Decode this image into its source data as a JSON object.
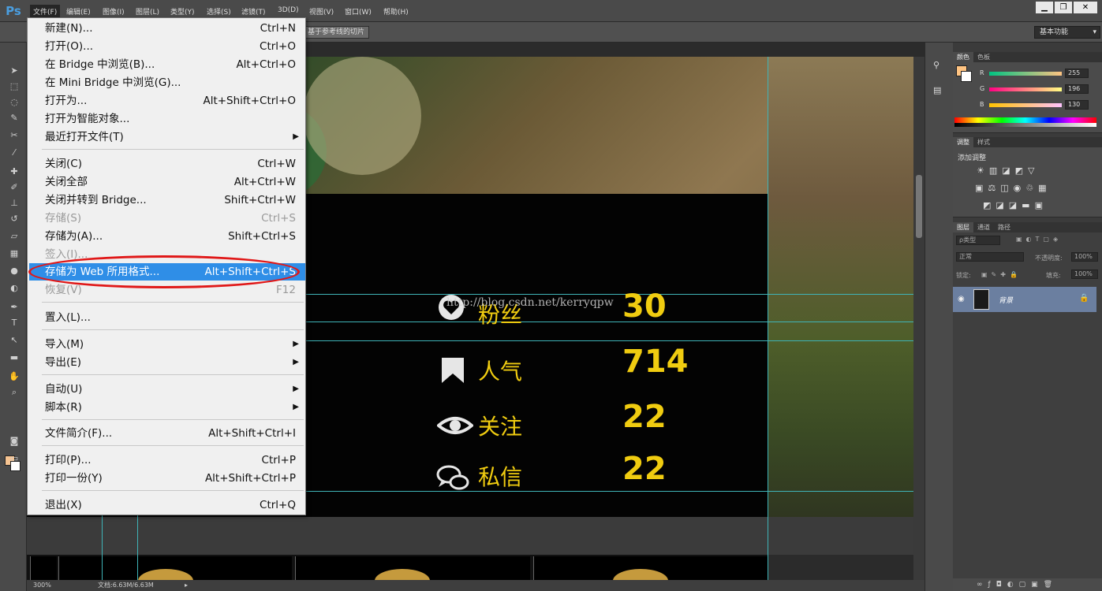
{
  "app": {
    "logo": "Ps"
  },
  "menubar": {
    "items": [
      "文件(F)",
      "编辑(E)",
      "图像(I)",
      "图层(L)",
      "类型(Y)",
      "选择(S)",
      "滤镜(T)",
      "3D(D)",
      "视图(V)",
      "窗口(W)",
      "帮助(H)"
    ]
  },
  "window_controls": {
    "minimize": "▁",
    "restore": "❐",
    "close": "✕"
  },
  "options_bar": {
    "slice_button": "基于参考线的切片",
    "workspace": "基本功能"
  },
  "file_menu": {
    "items": [
      {
        "label": "新建(N)...",
        "shortcut": "Ctrl+N",
        "state": "normal"
      },
      {
        "label": "打开(O)...",
        "shortcut": "Ctrl+O",
        "state": "normal"
      },
      {
        "label": "在 Bridge 中浏览(B)...",
        "shortcut": "Alt+Ctrl+O",
        "state": "normal"
      },
      {
        "label": "在 Mini Bridge 中浏览(G)...",
        "shortcut": "",
        "state": "normal"
      },
      {
        "label": "打开为...",
        "shortcut": "Alt+Shift+Ctrl+O",
        "state": "normal"
      },
      {
        "label": "打开为智能对象...",
        "shortcut": "",
        "state": "normal"
      },
      {
        "label": "最近打开文件(T)",
        "shortcut": "",
        "state": "submenu"
      },
      {
        "label": "关闭(C)",
        "shortcut": "Ctrl+W",
        "state": "normal"
      },
      {
        "label": "关闭全部",
        "shortcut": "Alt+Ctrl+W",
        "state": "normal"
      },
      {
        "label": "关闭并转到 Bridge...",
        "shortcut": "Shift+Ctrl+W",
        "state": "normal"
      },
      {
        "label": "存储(S)",
        "shortcut": "Ctrl+S",
        "state": "disabled"
      },
      {
        "label": "存储为(A)...",
        "shortcut": "Shift+Ctrl+S",
        "state": "normal"
      },
      {
        "label": "签入(I)...",
        "shortcut": "",
        "state": "disabled"
      },
      {
        "label": "存储为 Web 所用格式...",
        "shortcut": "Alt+Shift+Ctrl+S",
        "state": "highlighted"
      },
      {
        "label": "恢复(V)",
        "shortcut": "F12",
        "state": "disabled"
      },
      {
        "label": "置入(L)...",
        "shortcut": "",
        "state": "normal"
      },
      {
        "label": "导入(M)",
        "shortcut": "",
        "state": "submenu"
      },
      {
        "label": "导出(E)",
        "shortcut": "",
        "state": "submenu"
      },
      {
        "label": "自动(U)",
        "shortcut": "",
        "state": "submenu"
      },
      {
        "label": "脚本(R)",
        "shortcut": "",
        "state": "submenu"
      },
      {
        "label": "文件简介(F)...",
        "shortcut": "Alt+Shift+Ctrl+I",
        "state": "normal"
      },
      {
        "label": "打印(P)...",
        "shortcut": "Ctrl+P",
        "state": "normal"
      },
      {
        "label": "打印一份(Y)",
        "shortcut": "Alt+Shift+Ctrl+P",
        "state": "normal"
      },
      {
        "label": "退出(X)",
        "shortcut": "Ctrl+Q",
        "state": "normal"
      }
    ]
  },
  "canvas": {
    "watermark": "http://blog.csdn.net/kerryqpw",
    "stats": [
      {
        "label": "粉丝",
        "value": "30",
        "icon": "heart-icon"
      },
      {
        "label": "人气",
        "value": "714",
        "icon": "bookmark-icon"
      },
      {
        "label": "关注",
        "value": "22",
        "icon": "eye-icon"
      },
      {
        "label": "私信",
        "value": "22",
        "icon": "chat-icon"
      }
    ]
  },
  "status_bar": {
    "zoom": "300%",
    "doc": "文档:6.63M/6.63M"
  },
  "color_panel": {
    "tabs": [
      "颜色",
      "色板"
    ],
    "r": "255",
    "g": "196",
    "b": "130",
    "fg_color": "#ffc482"
  },
  "adjust_panel": {
    "tabs": [
      "调整",
      "样式"
    ],
    "title": "添加调整"
  },
  "layers_panel": {
    "tabs": [
      "图层",
      "通道",
      "路径"
    ],
    "filter": "ρ类型",
    "blend_mode": "正常",
    "opacity_label": "不透明度:",
    "opacity": "100%",
    "lock_label": "锁定:",
    "fill_label": "填充:",
    "fill": "100%",
    "layer_name": "背景"
  }
}
